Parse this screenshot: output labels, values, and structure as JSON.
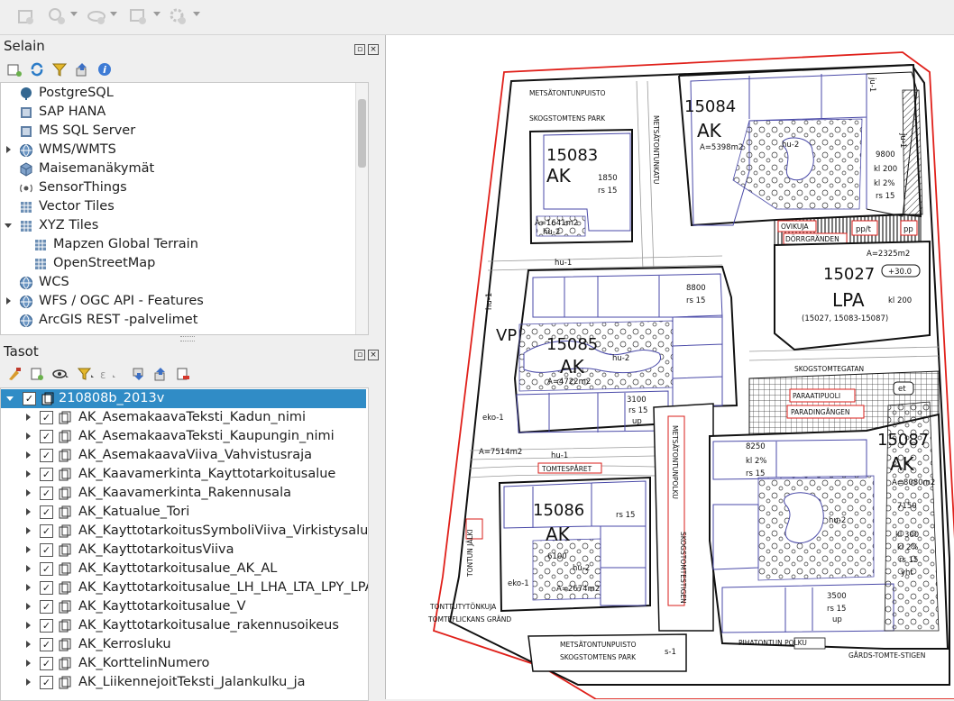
{
  "browser_panel": {
    "title": "Selain",
    "items": [
      {
        "label": "PostgreSQL",
        "icon": "postgresql-icon",
        "expander": false,
        "indent": 0
      },
      {
        "label": "SAP HANA",
        "icon": "sap-hana-icon",
        "expander": false,
        "indent": 0
      },
      {
        "label": "MS SQL Server",
        "icon": "mssql-icon",
        "expander": false,
        "indent": 0
      },
      {
        "label": "WMS/WMTS",
        "icon": "globe-icon",
        "expander": true,
        "indent": 0
      },
      {
        "label": "Maisemanäkymät",
        "icon": "cube-icon",
        "expander": false,
        "indent": 0
      },
      {
        "label": "SensorThings",
        "icon": "sensor-icon",
        "expander": false,
        "indent": 0
      },
      {
        "label": "Vector Tiles",
        "icon": "grid-icon",
        "expander": false,
        "indent": 0
      },
      {
        "label": "XYZ Tiles",
        "icon": "grid-icon",
        "expander": "open",
        "indent": 0
      },
      {
        "label": "Mapzen Global Terrain",
        "icon": "grid-icon",
        "expander": false,
        "indent": 1
      },
      {
        "label": "OpenStreetMap",
        "icon": "grid-icon",
        "expander": false,
        "indent": 1
      },
      {
        "label": "WCS",
        "icon": "globe-icon",
        "expander": false,
        "indent": 0
      },
      {
        "label": "WFS / OGC API - Features",
        "icon": "globe-icon",
        "expander": true,
        "indent": 0
      },
      {
        "label": "ArcGIS REST -palvelimet",
        "icon": "globe-icon",
        "expander": false,
        "indent": 0
      }
    ]
  },
  "layers_panel": {
    "title": "Tasot",
    "group": "210808b_2013v",
    "layers": [
      "AK_AsemakaavaTeksti_Kadun_nimi",
      "AK_AsemakaavaTeksti_Kaupungin_nimi",
      "AK_AsemakaavaViiva_Vahvistusraja",
      "AK_Kaavamerkinta_Kayttotarkoitusalue",
      "AK_Kaavamerkinta_Rakennusala",
      "AK_Katualue_Tori",
      "AK_KayttotarkoitusSymboliViiva_Virkistysalueen",
      "AK_KayttotarkoitusViiva",
      "AK_Kayttotarkoitusalue_AK_AL",
      "AK_Kayttotarkoitusalue_LH_LHA_LTA_LPY_LPA",
      "AK_Kayttotarkoitusalue_V",
      "AK_Kayttotarkoitusalue_rakennusoikeus",
      "AK_Kerrosluku",
      "AK_KorttelinNumero",
      "AK_LiikennejoitTeksti_Jalankulku_ja"
    ]
  },
  "map_labels": {
    "b15083": "15083",
    "ak1": "AK",
    "b15084": "15084",
    "ak2": "AK",
    "b15085": "15085",
    "ak3": "AK",
    "b15027": "15027",
    "lpa": "LPA",
    "b15086": "15086",
    "ak4": "AK",
    "b15087": "15087",
    "ak5": "AK",
    "vp": "VP",
    "park1a": "METSÄTONTUNPUISTO",
    "park1b": "SKOGSTOMTENS PARK",
    "park2a": "METSÄTONTUNPUISTO",
    "park2b": "SKOGSTOMTENS PARK",
    "street1": "METSÄTONTUNKATU",
    "street2": "SKOGSTOMTEGATAN",
    "path1": "METSÄTONTUNPOLKU",
    "path2": "SKOGSTOMTESTIGEN",
    "lane1": "TONTTUTYTÖNKUJA",
    "lane2": "TOMTEFLICKANS GRÄND",
    "ovikuja": "OVIKUJA",
    "dorr": "DÖRRGRÄNDEN",
    "paraati": "PARAATIPUOLI",
    "parad": "PARADINGÅNGEN",
    "tomtesp": "TOMTESPÅRET",
    "tontunjalki": "TONTUN JÄLKI",
    "pihatontun": "PIHATONTUN POLKU",
    "gards": "GÅRDS-TOMTE-STIGEN",
    "a5398": "A=5398m2",
    "a1641": "A=1641m2",
    "a2325": "A=2325m2",
    "a4722": "A=4722m2",
    "a7514": "A=7514m2",
    "a2674": "A=2674m2",
    "a8080": "A=8080m2",
    "n9800": "9800",
    "kl200a": "kl 200",
    "kl2a": "kl 2%",
    "rs15a": "rs 15",
    "n1850": "1850",
    "rs15b": "rs 15",
    "n8800": "8800",
    "rs15c": "rs 15",
    "n3100": "3100",
    "rs15d": "rs 15",
    "up1": "up",
    "n8250": "8250",
    "kl2b": "kl 2%",
    "rs15e": "rs 15",
    "n7150": "7150",
    "kl300": "kl 300",
    "kl2c": "kl 2%",
    "rs15f": "rs 15",
    "yht1": "yht",
    "n6100": "6100",
    "rs15g": "rs 15",
    "n3500": "3500",
    "rs15h": "rs 15",
    "up2": "up",
    "kl200b": "kl 200",
    "p30": "+30.0",
    "lpa_list": "(15027, 15083-15087)",
    "hu1a": "hu-1",
    "hu1b": "hu-1",
    "hu1c": "hu-1",
    "hu2a": "hu-2",
    "hu2b": "hu-2",
    "hu2c": "hu-2",
    "hu2d": "hu-2",
    "hu2e": "hu-2",
    "eko1a": "eko-1",
    "eko1b": "eko-1",
    "ppt": "pp/t",
    "pp": "pp",
    "et": "et",
    "s1": "s-1",
    "ju1a": "ju-1",
    "ju1b": "ju-1"
  }
}
